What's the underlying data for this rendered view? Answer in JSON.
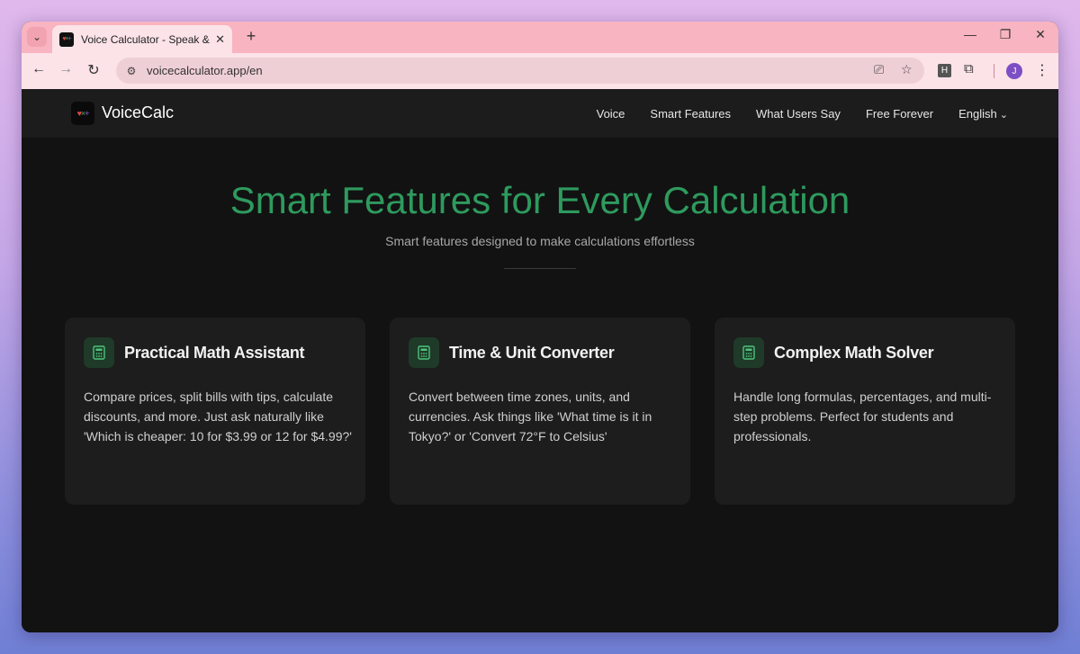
{
  "browser": {
    "tab_title": "Voice Calculator - Speak & Solve",
    "close_glyph": "✕",
    "new_tab_glyph": "+",
    "minimize_glyph": "—",
    "restore_glyph": "❐",
    "close_window_glyph": "✕",
    "back_glyph": "←",
    "forward_glyph": "→",
    "reload_glyph": "↻",
    "url": "voicecalculator.app/en",
    "ext_h": "H",
    "avatar_letter": "J",
    "menu_glyph": "⋮"
  },
  "site": {
    "logo_text": "VoiceCalc",
    "nav": {
      "voice": "Voice",
      "smart_features": "Smart Features",
      "what_users_say": "What Users Say",
      "free_forever": "Free Forever",
      "language": "English"
    },
    "hero": {
      "title": "Smart Features for Every Calculation",
      "subtitle": "Smart features designed to make calculations effortless"
    },
    "cards": [
      {
        "title": "Practical Math Assistant",
        "text": "Compare prices, split bills with tips, calculate discounts, and more. Just ask naturally like 'Which is cheaper: 10 for $3.99 or 12 for $4.99?'",
        "icon": "calculator-icon"
      },
      {
        "title": "Time & Unit Converter",
        "text": "Convert between time zones, units, and currencies. Ask things like 'What time is it in Tokyo?' or 'Convert 72°F to Celsius'",
        "icon": "calculator-icon"
      },
      {
        "title": "Complex Math Solver",
        "text": "Handle long formulas, percentages, and multi-step problems. Perfect for students and professionals.",
        "icon": "calculator-icon"
      }
    ]
  },
  "colors": {
    "accent_green": "#2e9a5e",
    "tab_strip": "#f8b4c0",
    "page_bg": "#121212",
    "card_bg": "#1d1d1d"
  }
}
